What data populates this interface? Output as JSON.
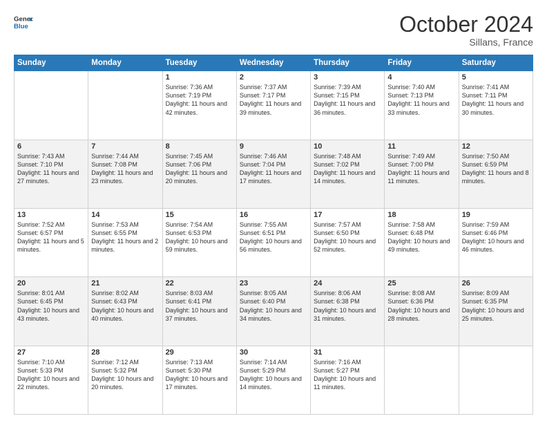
{
  "header": {
    "logo_line1": "General",
    "logo_line2": "Blue",
    "month": "October 2024",
    "location": "Sillans, France"
  },
  "days_of_week": [
    "Sunday",
    "Monday",
    "Tuesday",
    "Wednesday",
    "Thursday",
    "Friday",
    "Saturday"
  ],
  "weeks": [
    [
      {
        "day": "",
        "info": ""
      },
      {
        "day": "",
        "info": ""
      },
      {
        "day": "1",
        "info": "Sunrise: 7:36 AM\nSunset: 7:19 PM\nDaylight: 11 hours and 42 minutes."
      },
      {
        "day": "2",
        "info": "Sunrise: 7:37 AM\nSunset: 7:17 PM\nDaylight: 11 hours and 39 minutes."
      },
      {
        "day": "3",
        "info": "Sunrise: 7:39 AM\nSunset: 7:15 PM\nDaylight: 11 hours and 36 minutes."
      },
      {
        "day": "4",
        "info": "Sunrise: 7:40 AM\nSunset: 7:13 PM\nDaylight: 11 hours and 33 minutes."
      },
      {
        "day": "5",
        "info": "Sunrise: 7:41 AM\nSunset: 7:11 PM\nDaylight: 11 hours and 30 minutes."
      }
    ],
    [
      {
        "day": "6",
        "info": "Sunrise: 7:43 AM\nSunset: 7:10 PM\nDaylight: 11 hours and 27 minutes."
      },
      {
        "day": "7",
        "info": "Sunrise: 7:44 AM\nSunset: 7:08 PM\nDaylight: 11 hours and 23 minutes."
      },
      {
        "day": "8",
        "info": "Sunrise: 7:45 AM\nSunset: 7:06 PM\nDaylight: 11 hours and 20 minutes."
      },
      {
        "day": "9",
        "info": "Sunrise: 7:46 AM\nSunset: 7:04 PM\nDaylight: 11 hours and 17 minutes."
      },
      {
        "day": "10",
        "info": "Sunrise: 7:48 AM\nSunset: 7:02 PM\nDaylight: 11 hours and 14 minutes."
      },
      {
        "day": "11",
        "info": "Sunrise: 7:49 AM\nSunset: 7:00 PM\nDaylight: 11 hours and 11 minutes."
      },
      {
        "day": "12",
        "info": "Sunrise: 7:50 AM\nSunset: 6:59 PM\nDaylight: 11 hours and 8 minutes."
      }
    ],
    [
      {
        "day": "13",
        "info": "Sunrise: 7:52 AM\nSunset: 6:57 PM\nDaylight: 11 hours and 5 minutes."
      },
      {
        "day": "14",
        "info": "Sunrise: 7:53 AM\nSunset: 6:55 PM\nDaylight: 11 hours and 2 minutes."
      },
      {
        "day": "15",
        "info": "Sunrise: 7:54 AM\nSunset: 6:53 PM\nDaylight: 10 hours and 59 minutes."
      },
      {
        "day": "16",
        "info": "Sunrise: 7:55 AM\nSunset: 6:51 PM\nDaylight: 10 hours and 56 minutes."
      },
      {
        "day": "17",
        "info": "Sunrise: 7:57 AM\nSunset: 6:50 PM\nDaylight: 10 hours and 52 minutes."
      },
      {
        "day": "18",
        "info": "Sunrise: 7:58 AM\nSunset: 6:48 PM\nDaylight: 10 hours and 49 minutes."
      },
      {
        "day": "19",
        "info": "Sunrise: 7:59 AM\nSunset: 6:46 PM\nDaylight: 10 hours and 46 minutes."
      }
    ],
    [
      {
        "day": "20",
        "info": "Sunrise: 8:01 AM\nSunset: 6:45 PM\nDaylight: 10 hours and 43 minutes."
      },
      {
        "day": "21",
        "info": "Sunrise: 8:02 AM\nSunset: 6:43 PM\nDaylight: 10 hours and 40 minutes."
      },
      {
        "day": "22",
        "info": "Sunrise: 8:03 AM\nSunset: 6:41 PM\nDaylight: 10 hours and 37 minutes."
      },
      {
        "day": "23",
        "info": "Sunrise: 8:05 AM\nSunset: 6:40 PM\nDaylight: 10 hours and 34 minutes."
      },
      {
        "day": "24",
        "info": "Sunrise: 8:06 AM\nSunset: 6:38 PM\nDaylight: 10 hours and 31 minutes."
      },
      {
        "day": "25",
        "info": "Sunrise: 8:08 AM\nSunset: 6:36 PM\nDaylight: 10 hours and 28 minutes."
      },
      {
        "day": "26",
        "info": "Sunrise: 8:09 AM\nSunset: 6:35 PM\nDaylight: 10 hours and 25 minutes."
      }
    ],
    [
      {
        "day": "27",
        "info": "Sunrise: 7:10 AM\nSunset: 5:33 PM\nDaylight: 10 hours and 22 minutes."
      },
      {
        "day": "28",
        "info": "Sunrise: 7:12 AM\nSunset: 5:32 PM\nDaylight: 10 hours and 20 minutes."
      },
      {
        "day": "29",
        "info": "Sunrise: 7:13 AM\nSunset: 5:30 PM\nDaylight: 10 hours and 17 minutes."
      },
      {
        "day": "30",
        "info": "Sunrise: 7:14 AM\nSunset: 5:29 PM\nDaylight: 10 hours and 14 minutes."
      },
      {
        "day": "31",
        "info": "Sunrise: 7:16 AM\nSunset: 5:27 PM\nDaylight: 10 hours and 11 minutes."
      },
      {
        "day": "",
        "info": ""
      },
      {
        "day": "",
        "info": ""
      }
    ]
  ]
}
